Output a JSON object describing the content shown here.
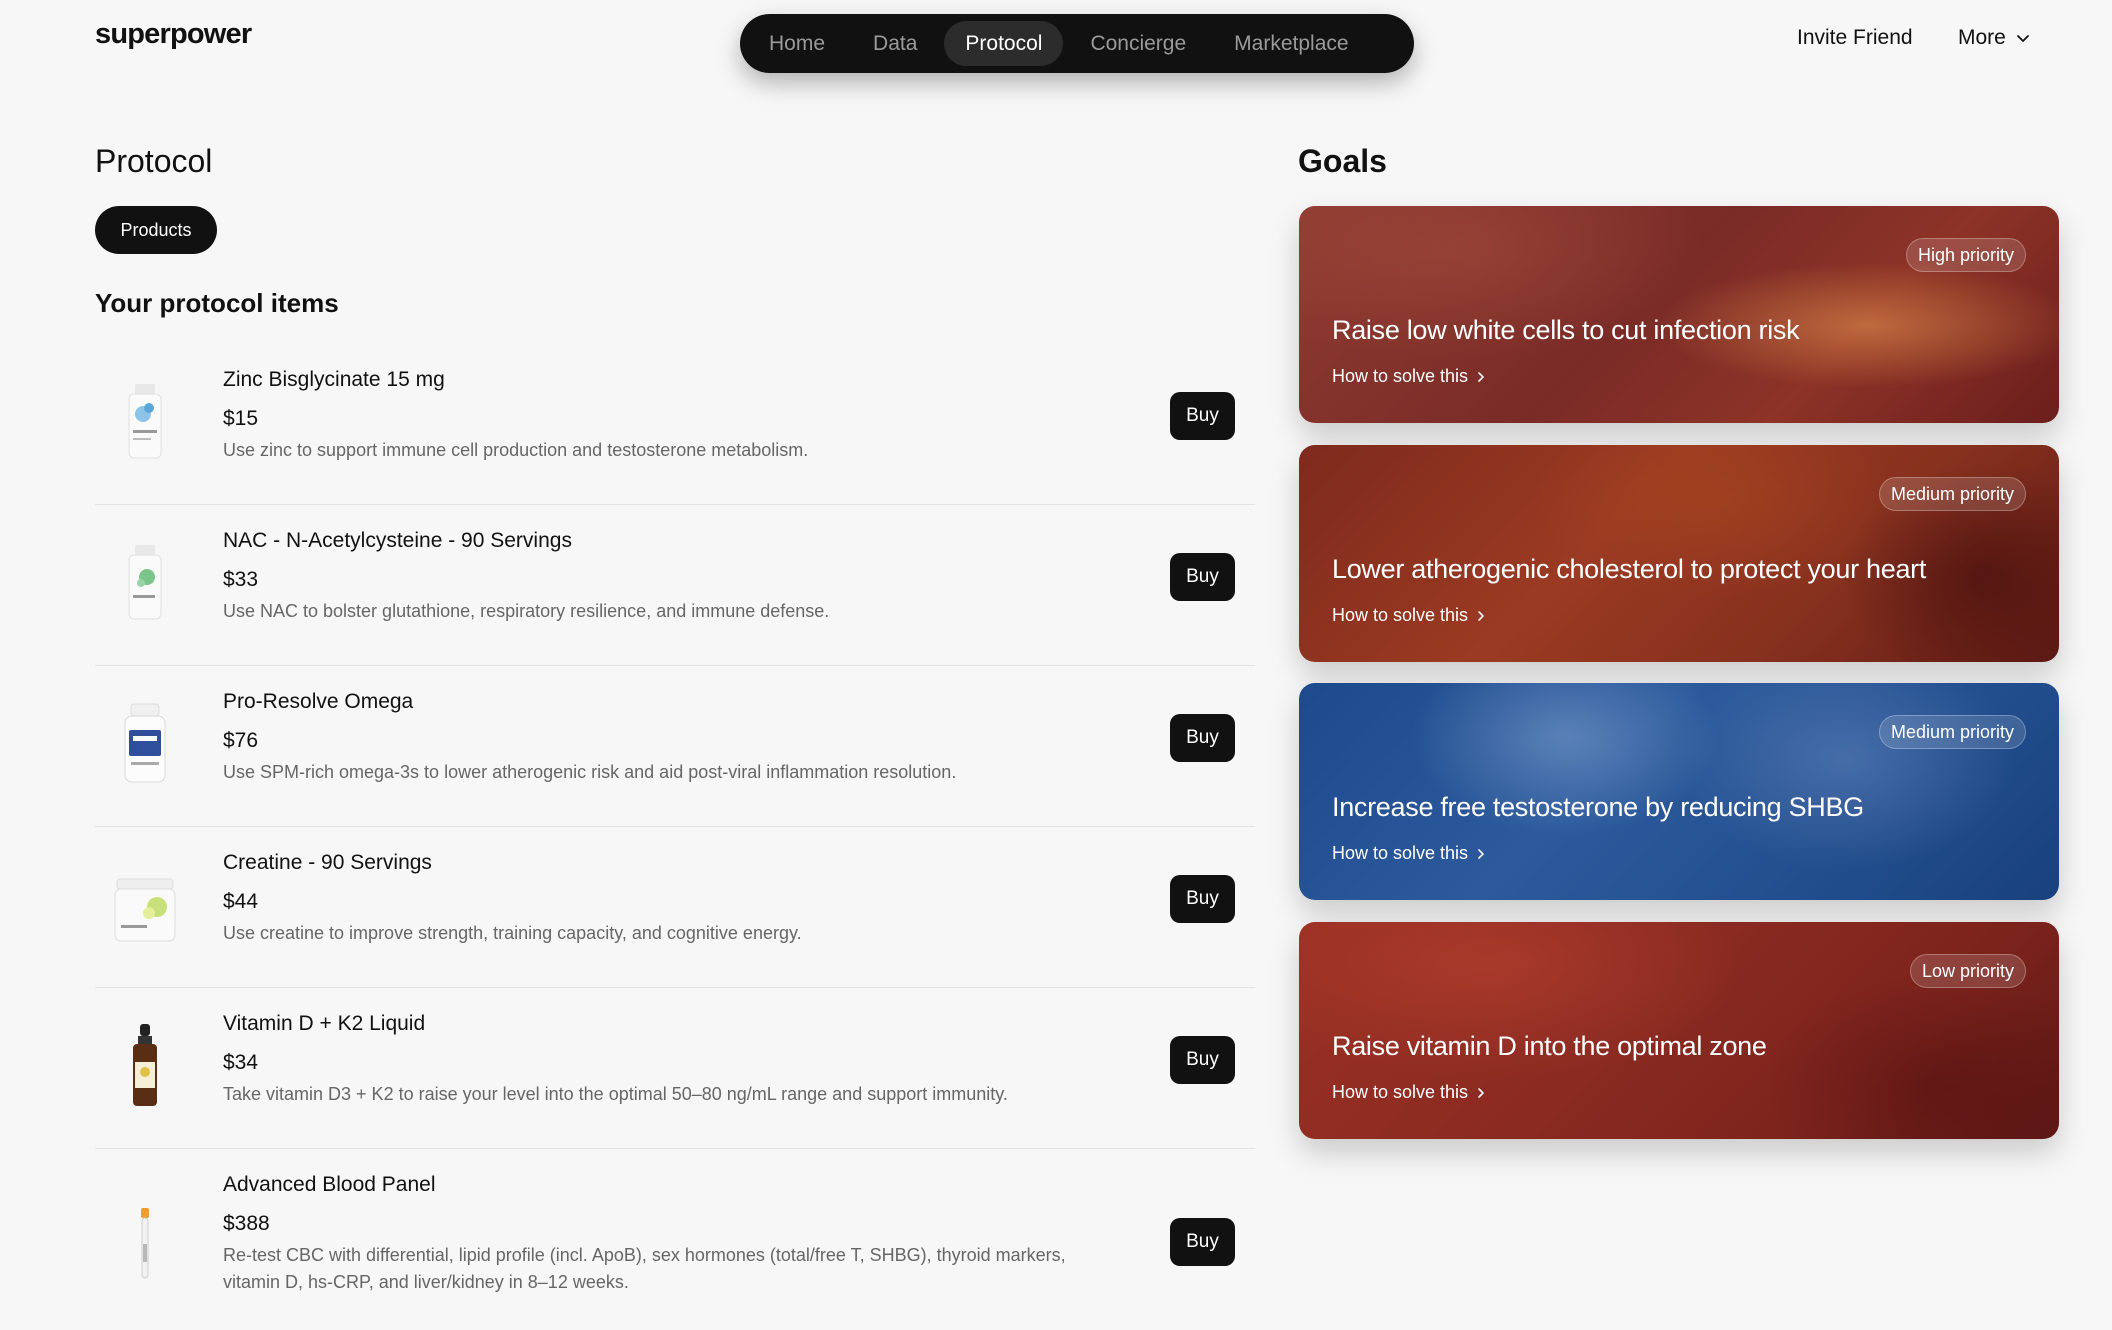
{
  "header": {
    "logo": "superpower",
    "nav": [
      "Home",
      "Data",
      "Protocol",
      "Concierge",
      "Marketplace"
    ],
    "active_nav": "Protocol",
    "invite": "Invite Friend",
    "more": "More"
  },
  "protocol": {
    "title": "Protocol",
    "filter": "Products",
    "section_title": "Your protocol items",
    "buy_label": "Buy",
    "items": [
      {
        "name": "Zinc Bisglycinate 15 mg",
        "price": "$15",
        "desc": "Use zinc to support immune cell production and testosterone metabolism."
      },
      {
        "name": "NAC - N-Acetylcysteine - 90 Servings",
        "price": "$33",
        "desc": "Use NAC to bolster glutathione, respiratory resilience, and immune defense."
      },
      {
        "name": "Pro-Resolve Omega",
        "price": "$76",
        "desc": "Use SPM-rich omega-3s to lower atherogenic risk and aid post-viral inflammation resolution."
      },
      {
        "name": "Creatine - 90 Servings",
        "price": "$44",
        "desc": "Use creatine to improve strength, training capacity, and cognitive energy."
      },
      {
        "name": "Vitamin D + K2 Liquid",
        "price": "$34",
        "desc": "Take vitamin D3 + K2 to raise your level into the optimal 50–80 ng/mL range and support immunity."
      },
      {
        "name": "Advanced Blood Panel",
        "price": "$388",
        "desc": "Re-test CBC with differential, lipid profile (incl. ApoB), sex hormones (total/free T, SHBG), thyroid markers, vitamin D, hs-CRP, and liver/kidney in 8–12 weeks."
      }
    ]
  },
  "goals": {
    "title": "Goals",
    "how_to_label": "How to solve this",
    "cards": [
      {
        "priority": "High priority",
        "title": "Raise low white cells to cut infection risk"
      },
      {
        "priority": "Medium priority",
        "title": "Lower atherogenic cholesterol to protect your heart"
      },
      {
        "priority": "Medium priority",
        "title": "Increase free testosterone by reducing SHBG"
      },
      {
        "priority": "Low priority",
        "title": "Raise vitamin D into the optimal zone"
      }
    ]
  }
}
